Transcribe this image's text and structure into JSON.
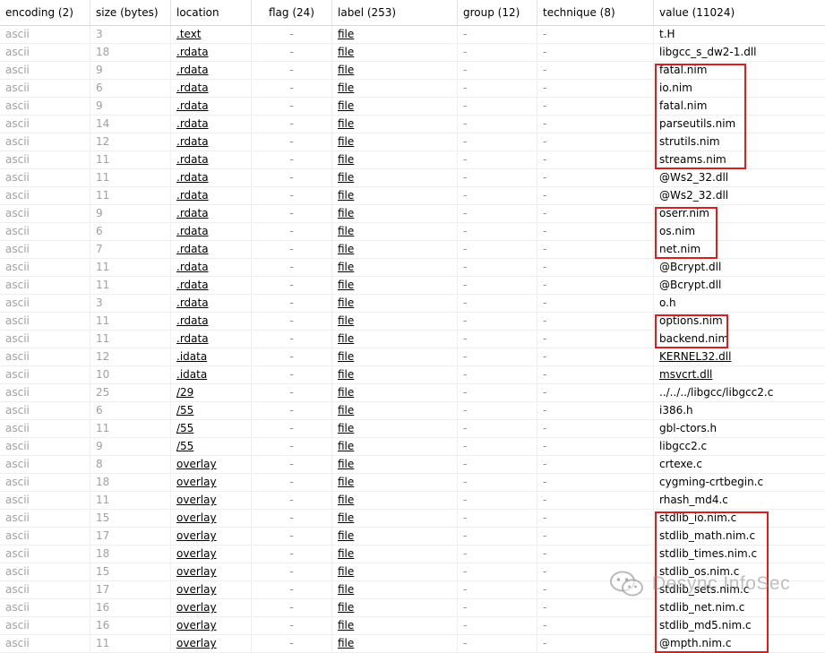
{
  "columns": {
    "encoding": "encoding (2)",
    "size": "size (bytes)",
    "location": "location",
    "flag": "flag (24)",
    "label": "label (253)",
    "group": "group (12)",
    "technique": "technique (8)",
    "value": "value (11024)"
  },
  "rows": [
    {
      "encoding": "ascii",
      "size": "3",
      "location": ".text",
      "flag": "-",
      "label": "file",
      "group": "-",
      "technique": "-",
      "value": "t.H"
    },
    {
      "encoding": "ascii",
      "size": "18",
      "location": ".rdata",
      "flag": "-",
      "label": "file",
      "group": "-",
      "technique": "-",
      "value": "libgcc_s_dw2-1.dll"
    },
    {
      "encoding": "ascii",
      "size": "9",
      "location": ".rdata",
      "flag": "-",
      "label": "file",
      "group": "-",
      "technique": "-",
      "value": "fatal.nim"
    },
    {
      "encoding": "ascii",
      "size": "6",
      "location": ".rdata",
      "flag": "-",
      "label": "file",
      "group": "-",
      "technique": "-",
      "value": "io.nim"
    },
    {
      "encoding": "ascii",
      "size": "9",
      "location": ".rdata",
      "flag": "-",
      "label": "file",
      "group": "-",
      "technique": "-",
      "value": "fatal.nim"
    },
    {
      "encoding": "ascii",
      "size": "14",
      "location": ".rdata",
      "flag": "-",
      "label": "file",
      "group": "-",
      "technique": "-",
      "value": "parseutils.nim"
    },
    {
      "encoding": "ascii",
      "size": "12",
      "location": ".rdata",
      "flag": "-",
      "label": "file",
      "group": "-",
      "technique": "-",
      "value": "strutils.nim"
    },
    {
      "encoding": "ascii",
      "size": "11",
      "location": ".rdata",
      "flag": "-",
      "label": "file",
      "group": "-",
      "technique": "-",
      "value": "streams.nim"
    },
    {
      "encoding": "ascii",
      "size": "11",
      "location": ".rdata",
      "flag": "-",
      "label": "file",
      "group": "-",
      "technique": "-",
      "value": "@Ws2_32.dll"
    },
    {
      "encoding": "ascii",
      "size": "11",
      "location": ".rdata",
      "flag": "-",
      "label": "file",
      "group": "-",
      "technique": "-",
      "value": "@Ws2_32.dll"
    },
    {
      "encoding": "ascii",
      "size": "9",
      "location": ".rdata",
      "flag": "-",
      "label": "file",
      "group": "-",
      "technique": "-",
      "value": "oserr.nim"
    },
    {
      "encoding": "ascii",
      "size": "6",
      "location": ".rdata",
      "flag": "-",
      "label": "file",
      "group": "-",
      "technique": "-",
      "value": "os.nim"
    },
    {
      "encoding": "ascii",
      "size": "7",
      "location": ".rdata",
      "flag": "-",
      "label": "file",
      "group": "-",
      "technique": "-",
      "value": "net.nim"
    },
    {
      "encoding": "ascii",
      "size": "11",
      "location": ".rdata",
      "flag": "-",
      "label": "file",
      "group": "-",
      "technique": "-",
      "value": "@Bcrypt.dll"
    },
    {
      "encoding": "ascii",
      "size": "11",
      "location": ".rdata",
      "flag": "-",
      "label": "file",
      "group": "-",
      "technique": "-",
      "value": "@Bcrypt.dll"
    },
    {
      "encoding": "ascii",
      "size": "3",
      "location": ".rdata",
      "flag": "-",
      "label": "file",
      "group": "-",
      "technique": "-",
      "value": "o.h"
    },
    {
      "encoding": "ascii",
      "size": "11",
      "location": ".rdata",
      "flag": "-",
      "label": "file",
      "group": "-",
      "technique": "-",
      "value": "options.nim"
    },
    {
      "encoding": "ascii",
      "size": "11",
      "location": ".rdata",
      "flag": "-",
      "label": "file",
      "group": "-",
      "technique": "-",
      "value": "backend.nim"
    },
    {
      "encoding": "ascii",
      "size": "12",
      "location": ".idata",
      "flag": "-",
      "label": "file",
      "group": "-",
      "technique": "-",
      "value": "KERNEL32.dll",
      "value_link": true
    },
    {
      "encoding": "ascii",
      "size": "10",
      "location": ".idata",
      "flag": "-",
      "label": "file",
      "group": "-",
      "technique": "-",
      "value": "msvcrt.dll",
      "value_link": true
    },
    {
      "encoding": "ascii",
      "size": "25",
      "location": "/29",
      "flag": "-",
      "label": "file",
      "group": "-",
      "technique": "-",
      "value": "../../../libgcc/libgcc2.c"
    },
    {
      "encoding": "ascii",
      "size": "6",
      "location": "/55",
      "flag": "-",
      "label": "file",
      "group": "-",
      "technique": "-",
      "value": "i386.h"
    },
    {
      "encoding": "ascii",
      "size": "11",
      "location": "/55",
      "flag": "-",
      "label": "file",
      "group": "-",
      "technique": "-",
      "value": "gbl-ctors.h"
    },
    {
      "encoding": "ascii",
      "size": "9",
      "location": "/55",
      "flag": "-",
      "label": "file",
      "group": "-",
      "technique": "-",
      "value": "libgcc2.c"
    },
    {
      "encoding": "ascii",
      "size": "8",
      "location": "overlay",
      "flag": "-",
      "label": "file",
      "group": "-",
      "technique": "-",
      "value": "crtexe.c"
    },
    {
      "encoding": "ascii",
      "size": "18",
      "location": "overlay",
      "flag": "-",
      "label": "file",
      "group": "-",
      "technique": "-",
      "value": "cygming-crtbegin.c"
    },
    {
      "encoding": "ascii",
      "size": "11",
      "location": "overlay",
      "flag": "-",
      "label": "file",
      "group": "-",
      "technique": "-",
      "value": "rhash_md4.c"
    },
    {
      "encoding": "ascii",
      "size": "15",
      "location": "overlay",
      "flag": "-",
      "label": "file",
      "group": "-",
      "technique": "-",
      "value": "stdlib_io.nim.c"
    },
    {
      "encoding": "ascii",
      "size": "17",
      "location": "overlay",
      "flag": "-",
      "label": "file",
      "group": "-",
      "technique": "-",
      "value": "stdlib_math.nim.c"
    },
    {
      "encoding": "ascii",
      "size": "18",
      "location": "overlay",
      "flag": "-",
      "label": "file",
      "group": "-",
      "technique": "-",
      "value": "stdlib_times.nim.c"
    },
    {
      "encoding": "ascii",
      "size": "15",
      "location": "overlay",
      "flag": "-",
      "label": "file",
      "group": "-",
      "technique": "-",
      "value": "stdlib_os.nim.c"
    },
    {
      "encoding": "ascii",
      "size": "17",
      "location": "overlay",
      "flag": "-",
      "label": "file",
      "group": "-",
      "technique": "-",
      "value": "stdlib_sets.nim.c"
    },
    {
      "encoding": "ascii",
      "size": "16",
      "location": "overlay",
      "flag": "-",
      "label": "file",
      "group": "-",
      "technique": "-",
      "value": "stdlib_net.nim.c"
    },
    {
      "encoding": "ascii",
      "size": "16",
      "location": "overlay",
      "flag": "-",
      "label": "file",
      "group": "-",
      "technique": "-",
      "value": "stdlib_md5.nim.c"
    },
    {
      "encoding": "ascii",
      "size": "11",
      "location": "overlay",
      "flag": "-",
      "label": "file",
      "group": "-",
      "technique": "-",
      "value": "@mpth.nim.c"
    }
  ],
  "highlight_groups": [
    {
      "first_row": 2,
      "last_row": 7
    },
    {
      "first_row": 10,
      "last_row": 12
    },
    {
      "first_row": 16,
      "last_row": 17
    },
    {
      "first_row": 27,
      "last_row": 34
    }
  ],
  "highlight_color": "#e01b1b",
  "watermark": {
    "text": "Desync InfoSec",
    "icon": "wechat-icon"
  }
}
